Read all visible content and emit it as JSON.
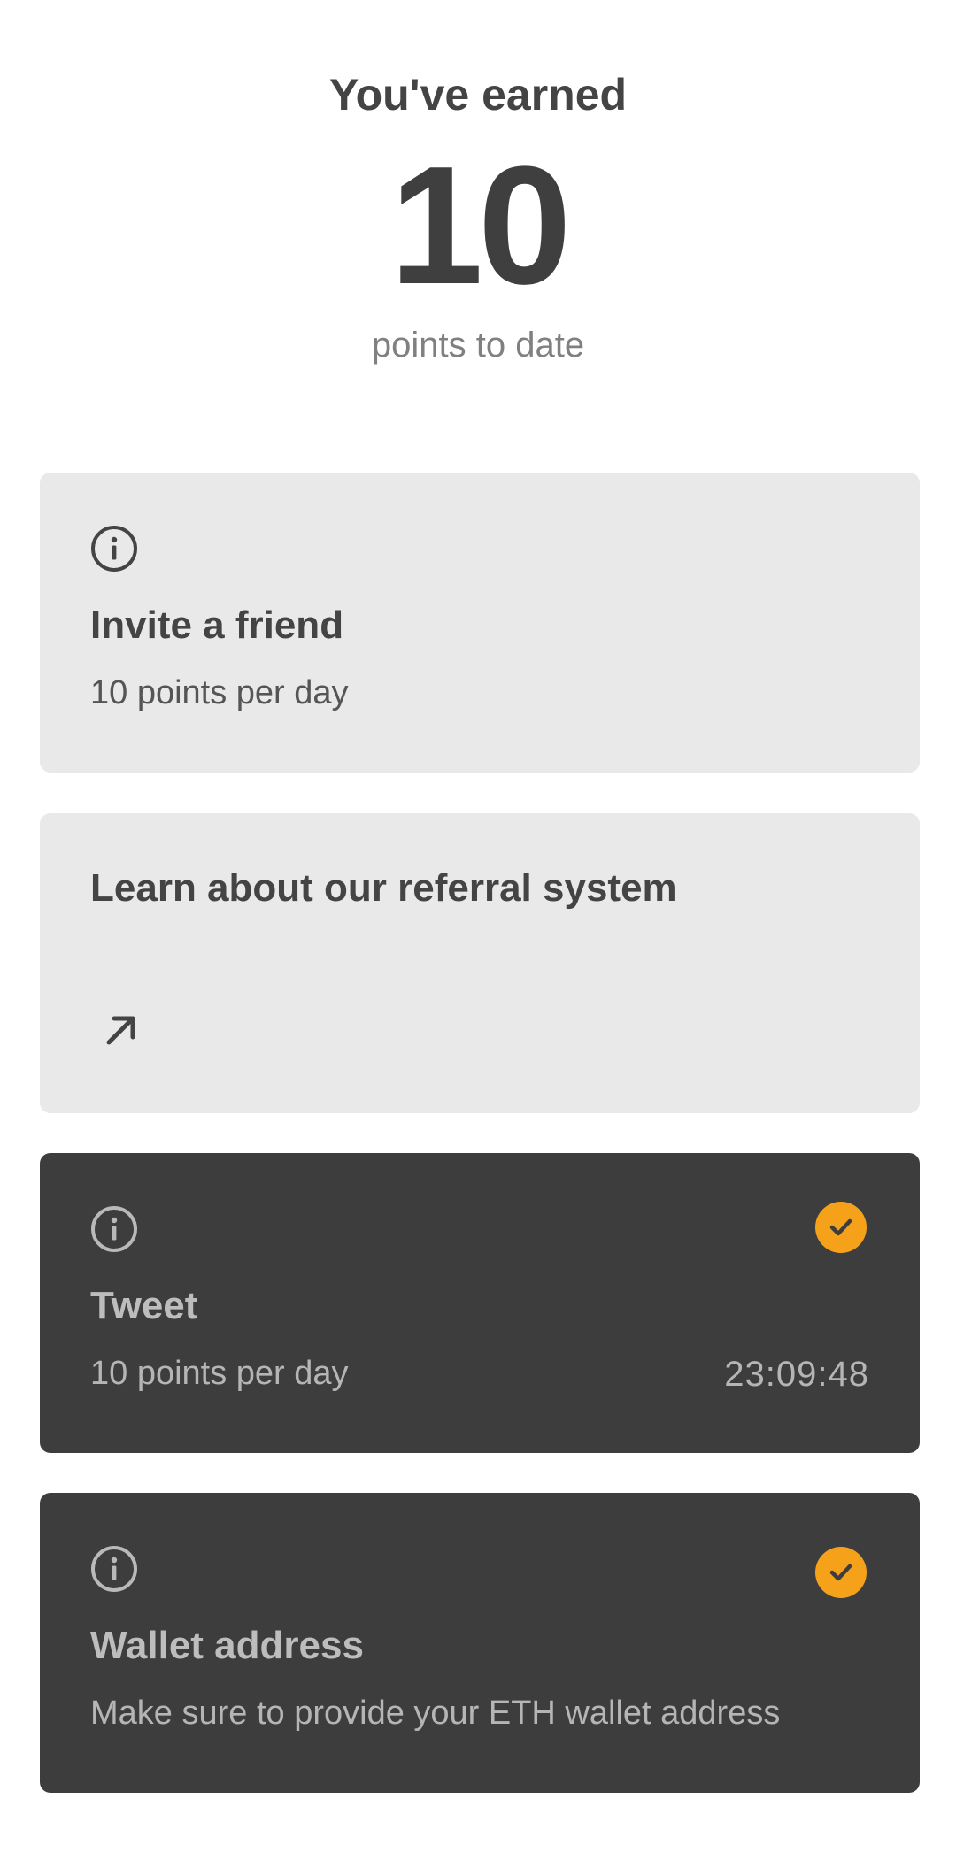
{
  "header": {
    "title": "You've earned",
    "points": "10",
    "caption": "points to date"
  },
  "cards": {
    "invite": {
      "icon": "info-icon",
      "title": "Invite a friend",
      "subtitle": "10 points per day"
    },
    "referral": {
      "title": "Learn about our referral system",
      "icon": "arrow-up-right-icon"
    },
    "tweet": {
      "icon": "info-icon",
      "title": "Tweet",
      "subtitle": "10 points per day",
      "timer": "23:09:48",
      "status_icon": "check-circle-icon"
    },
    "wallet": {
      "icon": "info-icon",
      "title": "Wallet address",
      "subtitle": "Make sure to provide your ETH wallet address",
      "status_icon": "check-circle-icon"
    }
  },
  "colors": {
    "accent": "#f6a11a",
    "light_card": "#e9e9e9",
    "dark_card": "#3d3d3d"
  }
}
